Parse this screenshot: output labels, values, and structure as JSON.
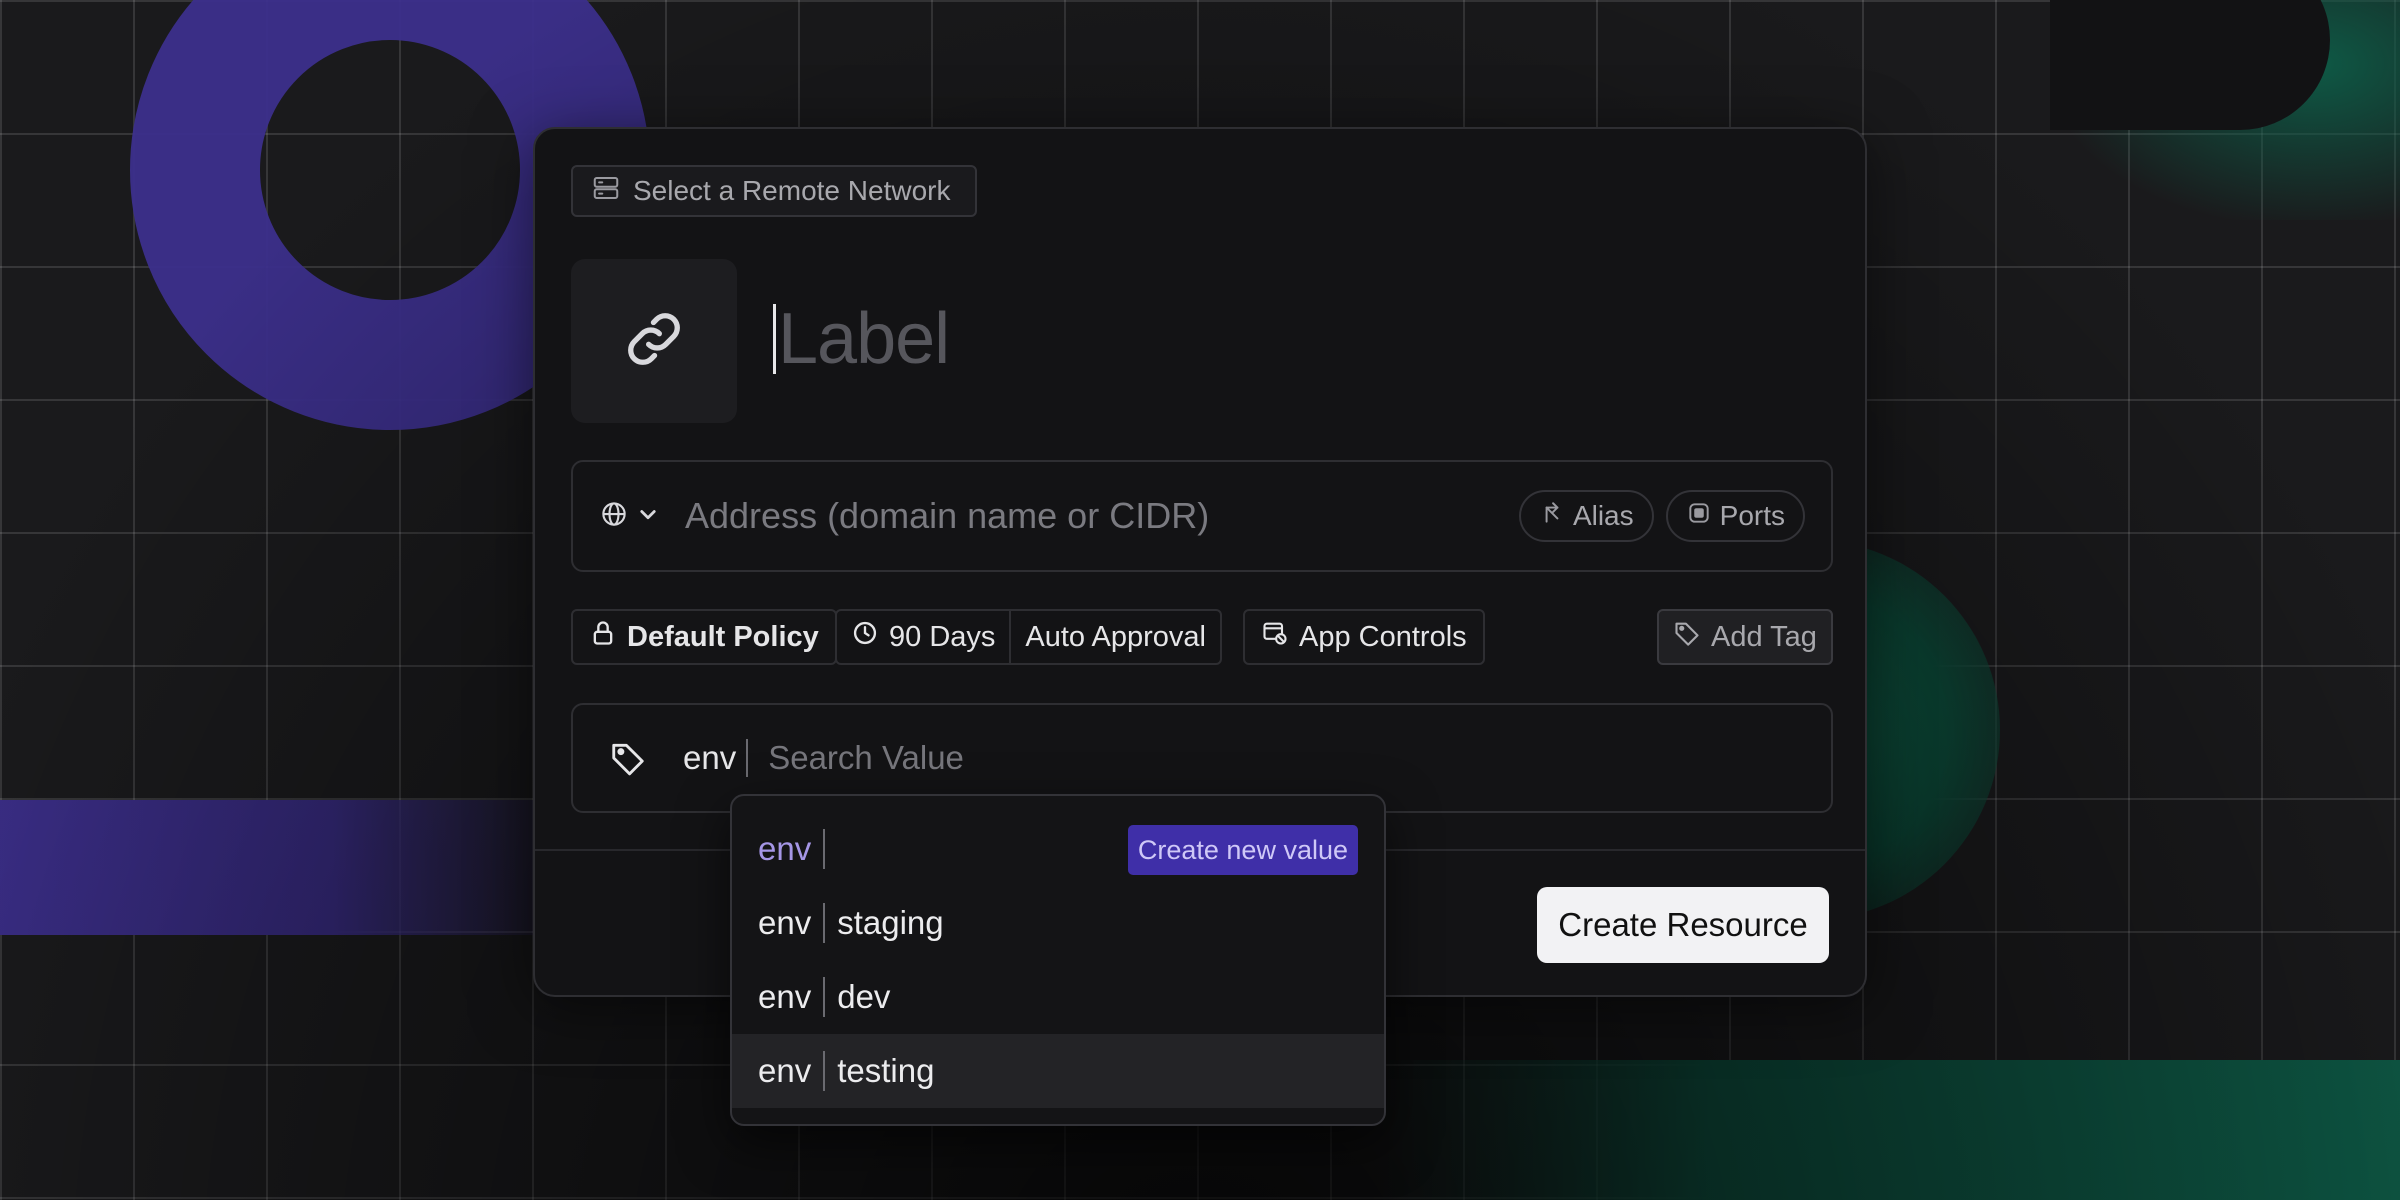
{
  "remote_network": {
    "label": "Select a Remote Network",
    "icon": "server-icon"
  },
  "resource": {
    "label_placeholder": "Label",
    "icon": "link-icon"
  },
  "address": {
    "placeholder": "Address (domain name or CIDR)",
    "protocol_icon": "globe-icon",
    "alias_label": "Alias",
    "ports_label": "Ports"
  },
  "policy": {
    "default_policy_label": "Default Policy",
    "duration_label": "90 Days",
    "approval_label": "Auto Approval",
    "app_controls_label": "App Controls",
    "add_tag_label": "Add Tag"
  },
  "tag_input": {
    "key": "env",
    "placeholder": "Search Value"
  },
  "create_button_label": "Create Resource",
  "dropdown": {
    "create_new_label": "Create new value",
    "items": [
      {
        "key": "env",
        "value": ""
      },
      {
        "key": "env",
        "value": "staging"
      },
      {
        "key": "env",
        "value": "dev"
      },
      {
        "key": "env",
        "value": "testing"
      }
    ],
    "highlighted_index": 3
  },
  "colors": {
    "accent_purple": "#3f2fa8",
    "background_purple_shape": "#3c2f8c",
    "background_green_shape": "#0e5a46",
    "primary_button": "#f2f2f4"
  }
}
